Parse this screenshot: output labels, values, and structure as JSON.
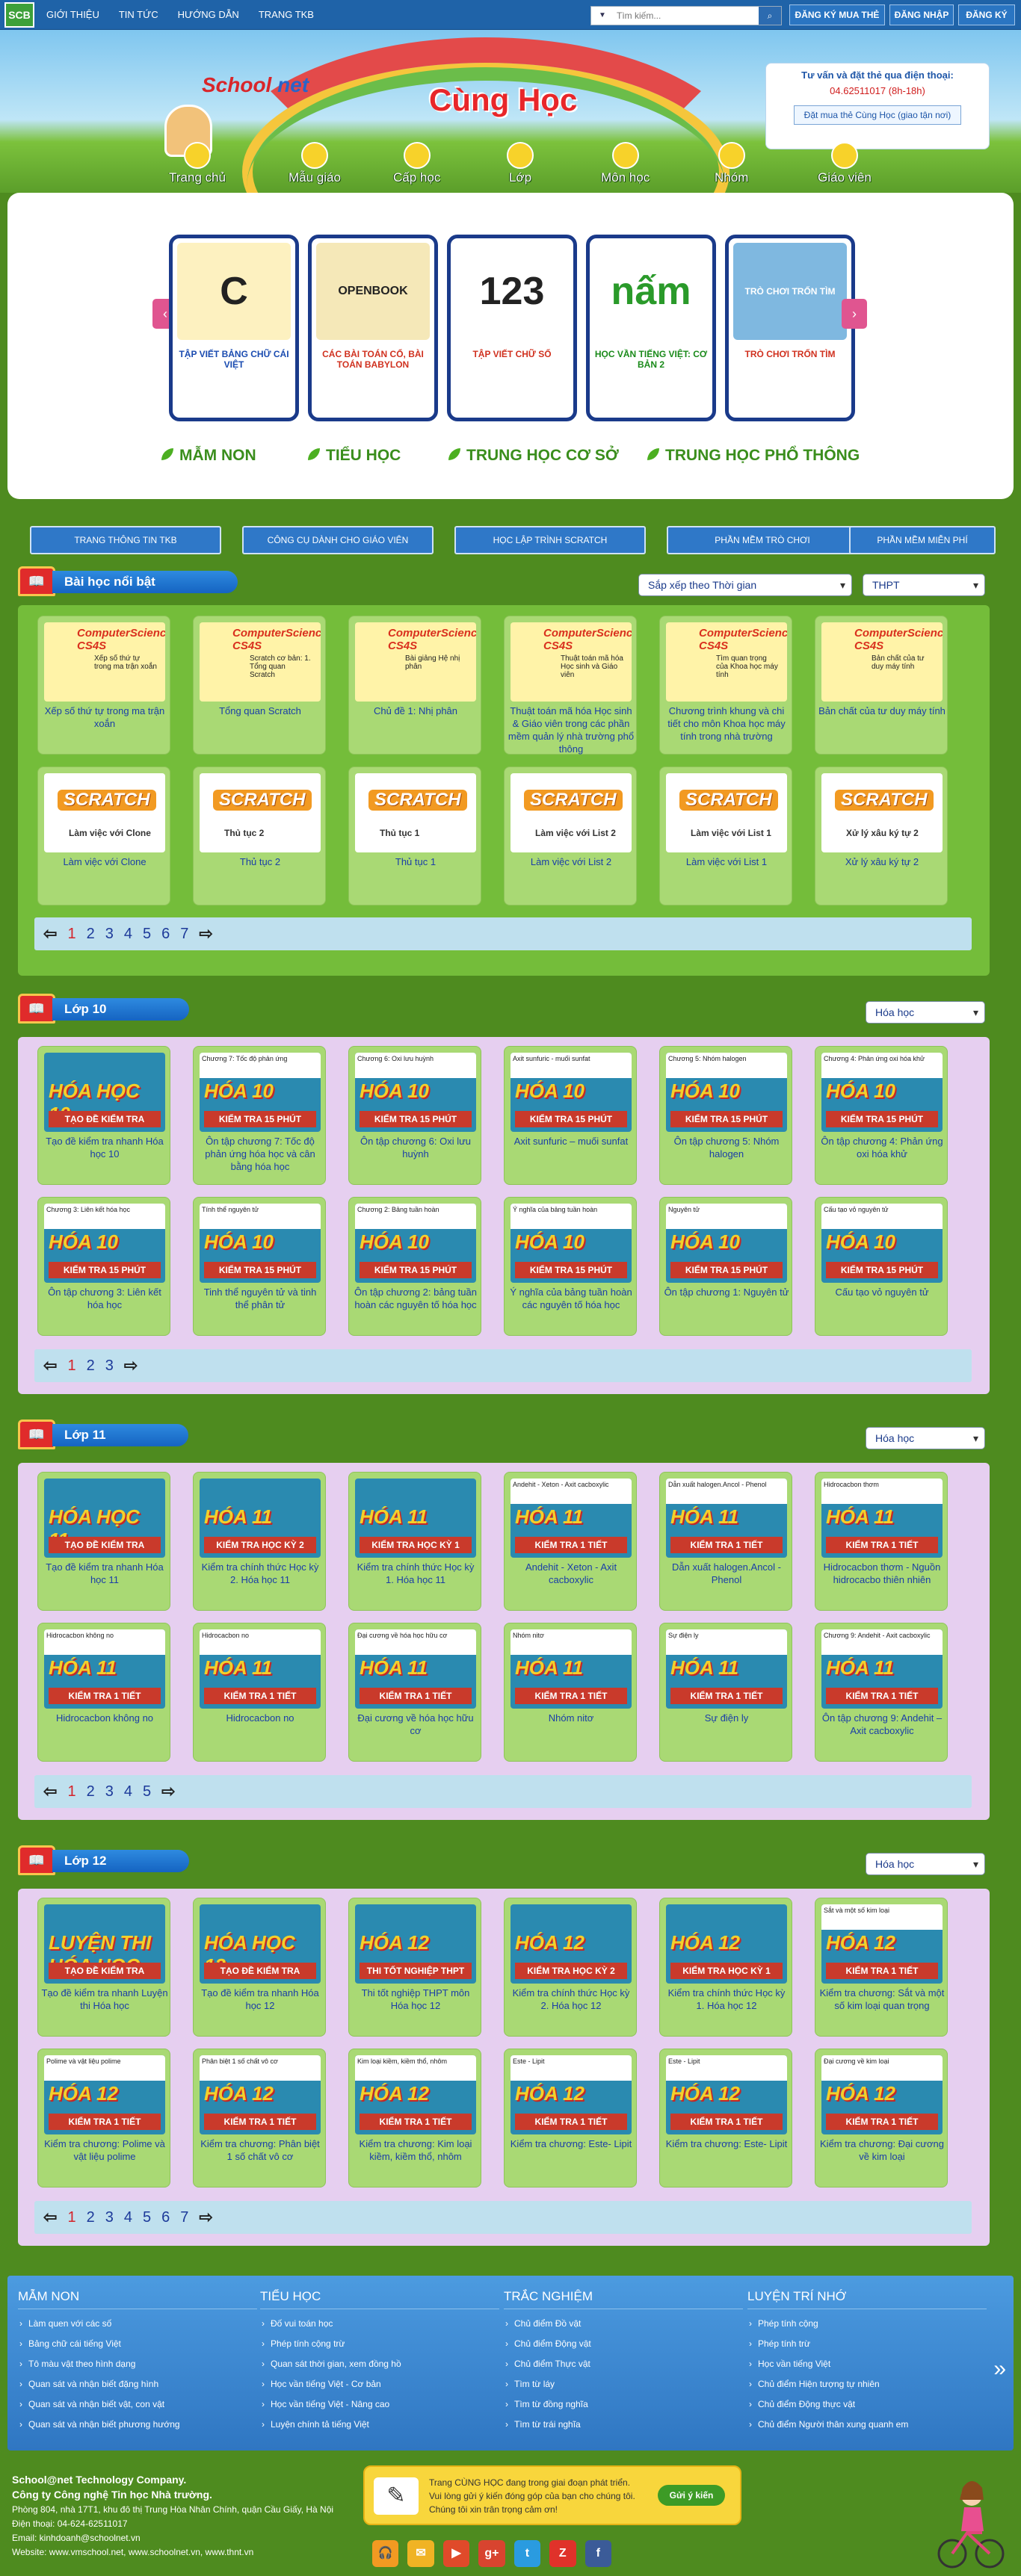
{
  "topbar": {
    "logo": "SCB",
    "nav": [
      "GIỚI THIỆU",
      "TIN TỨC",
      "HƯỚNG DẪN",
      "TRANG TKB"
    ],
    "search_placeholder": "Tìm kiếm...",
    "register_buy": "ĐĂNG KÝ MUA THẺ",
    "login": "ĐĂNG NHẬP",
    "signup": "ĐĂNG KÝ"
  },
  "header": {
    "brand_a": "School",
    "brand_b": "net",
    "title": "Cùng Học",
    "hotline_title": "Tư vấn và đặt thẻ qua điện thoại:",
    "hotline_number": "04.62511017 (8h-18h)",
    "buy_link": "Đặt mua thẻ Cùng Học (giao tận nơi)",
    "categories": [
      "Trang chủ",
      "Mẫu giáo",
      "Cấp học",
      "Lớp",
      "Môn học",
      "Nhóm",
      "Giáo viên"
    ]
  },
  "slider": [
    {
      "img": "C",
      "caption": "TẬP VIẾT BẢNG CHỮ CÁI VIỆT",
      "color": "#f1c64a"
    },
    {
      "img": "OPENBOOK",
      "caption": "CÁC BÀI TOÁN CỔ, BÀI TOÁN BABYLON",
      "color": "#6aa7e6"
    },
    {
      "img": "123",
      "caption": "TẬP VIẾT CHỮ SỐ",
      "color": "#6aa7e6"
    },
    {
      "img": "nấm",
      "caption": "HỌC VẦN TIẾNG VIỆT: CƠ BẢN 2",
      "color": "#e85656"
    },
    {
      "img": "TRÒ CHƠI TRỐN TÌM",
      "caption": "TRÒ CHƠI TRỐN TÌM",
      "color": "#8bc34a"
    }
  ],
  "levels": [
    "MẪM NON",
    "TIỂU HỌC",
    "TRUNG HỌC CƠ SỞ",
    "TRUNG HỌC PHỔ THÔNG"
  ],
  "tools": [
    "TRANG THÔNG TIN TKB",
    "CÔNG CỤ DÀNH CHO GIÁO VIÊN",
    "HỌC LẬP TRÌNH SCRATCH",
    "PHẦN MỀM TRÒ CHƠI",
    "PHẦN MỀM MIỄN PHÍ"
  ],
  "featured": {
    "title": "Bài học nổi bật",
    "sort": "Sắp xếp theo Thời gian",
    "level": "THPT",
    "cards": [
      {
        "head": "ComputerScience CS4S",
        "sub": "Xếp số thứ tự trong ma trận xoắn",
        "cap": "Xếp số thứ tự trong ma trận xoắn"
      },
      {
        "head": "ComputerScience CS4S",
        "sub": "Scratch cơ bản: 1. Tổng quan Scratch",
        "cap": "Tổng quan Scratch"
      },
      {
        "head": "ComputerScience CS4S",
        "sub": "Bài giảng Hệ nhị phân",
        "cap": "Chủ đề 1: Nhị phân"
      },
      {
        "head": "ComputerScience CS4S",
        "sub": "Thuật toán mã hóa Học sinh và Giáo viên",
        "cap": "Thuật toán mã hóa Học sinh & Giáo viên trong các phần mềm quản lý nhà trường phổ thông"
      },
      {
        "head": "ComputerScience CS4S",
        "sub": "Tìm quan trọng của Khoa học máy tính",
        "cap": "Chương trình khung và chi tiết cho môn Khoa học máy tính trong nhà trường"
      },
      {
        "head": "ComputerScience CS4S",
        "sub": "Bản chất của tư duy máy tính",
        "cap": "Bản chất của tư duy máy tính"
      },
      {
        "head": "SCRATCH",
        "sub": "Làm việc với Clone",
        "cap": "Làm việc với Clone"
      },
      {
        "head": "SCRATCH",
        "sub": "Thủ tục 2",
        "cap": "Thủ tục 2"
      },
      {
        "head": "SCRATCH",
        "sub": "Thủ tục 1",
        "cap": "Thủ tục 1"
      },
      {
        "head": "SCRATCH",
        "sub": "Làm việc với List 2",
        "cap": "Làm việc với List 2"
      },
      {
        "head": "SCRATCH",
        "sub": "Làm việc với List 1",
        "cap": "Làm việc với List 1"
      },
      {
        "head": "SCRATCH",
        "sub": "Xử lý xâu ký tự 2",
        "cap": "Xử lý xâu ký tự 2"
      }
    ],
    "pages": [
      "1",
      "2",
      "3",
      "4",
      "5",
      "6",
      "7"
    ]
  },
  "lop10": {
    "title": "Lớp 10",
    "subject": "Hóa học",
    "cards": [
      {
        "head": "",
        "sub": "HÓA HỌC 10",
        "band": "TẠO ĐỀ KIỂM TRA",
        "cap": "Tạo đề kiểm tra nhanh Hóa học 10"
      },
      {
        "head": "Chương 7: Tốc độ phản ứng",
        "sub": "HÓA 10",
        "band": "KIỂM TRA 15 PHÚT",
        "cap": "Ôn tập chương 7: Tốc độ phản ứng hóa học và cân bằng hóa học"
      },
      {
        "head": "Chương 6: Oxi lưu huỳnh",
        "sub": "HÓA 10",
        "band": "KIỂM TRA 15 PHÚT",
        "cap": "Ôn tập chương 6: Oxi lưu huỳnh"
      },
      {
        "head": "Axit sunfuric - muối sunfat",
        "sub": "HÓA 10",
        "band": "KIỂM TRA 15 PHÚT",
        "cap": "Axit sunfuric – muối sunfat"
      },
      {
        "head": "Chương 5: Nhóm halogen",
        "sub": "HÓA 10",
        "band": "KIỂM TRA 15 PHÚT",
        "cap": "Ôn tập chương 5: Nhóm halogen"
      },
      {
        "head": "Chương 4: Phản ứng oxi hóa khử",
        "sub": "HÓA 10",
        "band": "KIỂM TRA 15 PHÚT",
        "cap": "Ôn tập chương 4: Phản ứng oxi hóa khử"
      },
      {
        "head": "Chương 3: Liên kết hóa học",
        "sub": "HÓA 10",
        "band": "KIỂM TRA 15 PHÚT",
        "cap": "Ôn tập chương 3: Liên kết hóa học"
      },
      {
        "head": "Tính thể nguyên tử",
        "sub": "HÓA 10",
        "band": "KIỂM TRA 15 PHÚT",
        "cap": "Tinh thể nguyên tử và tinh thể phân tử"
      },
      {
        "head": "Chương 2: Bảng tuần hoàn",
        "sub": "HÓA 10",
        "band": "KIỂM TRA 15 PHÚT",
        "cap": "Ôn tập chương 2: bảng tuần hoàn các nguyên tố hóa học"
      },
      {
        "head": "Ý nghĩa của bảng tuần hoàn",
        "sub": "HÓA 10",
        "band": "KIỂM TRA 15 PHÚT",
        "cap": "Ý nghĩa của bảng tuần hoàn các nguyên tố hóa học"
      },
      {
        "head": "Nguyên tử",
        "sub": "HÓA 10",
        "band": "KIỂM TRA 15 PHÚT",
        "cap": "Ôn tập chương 1: Nguyên tử"
      },
      {
        "head": "Cấu tạo vỏ nguyên tử",
        "sub": "HÓA 10",
        "band": "KIỂM TRA 15 PHÚT",
        "cap": "Cấu tạo vỏ nguyên tử"
      }
    ],
    "pages": [
      "1",
      "2",
      "3"
    ]
  },
  "lop11": {
    "title": "Lớp 11",
    "subject": "Hóa học",
    "cards": [
      {
        "head": "",
        "sub": "HÓA HỌC 11",
        "band": "TẠO ĐỀ KIỂM TRA",
        "cap": "Tạo đề kiểm tra nhanh Hóa học 11"
      },
      {
        "head": "",
        "sub": "HÓA 11",
        "band": "KIỂM TRA HỌC KỲ 2",
        "cap": "Kiểm tra chính thức Học kỳ 2. Hóa học 11"
      },
      {
        "head": "",
        "sub": "HÓA 11",
        "band": "KIỂM TRA HỌC KỲ 1",
        "cap": "Kiểm tra chính thức Học kỳ 1. Hóa học 11"
      },
      {
        "head": "Andehit - Xeton - Axit cacboxylic",
        "sub": "HÓA 11",
        "band": "KIỂM TRA 1 TIẾT",
        "cap": "Andehit - Xeton - Axit cacboxylic"
      },
      {
        "head": "Dẫn xuất halogen.Ancol - Phenol",
        "sub": "HÓA 11",
        "band": "KIỂM TRA 1 TIẾT",
        "cap": "Dẫn xuất halogen.Ancol - Phenol"
      },
      {
        "head": "Hidrocacbon thơm",
        "sub": "HÓA 11",
        "band": "KIỂM TRA 1 TIẾT",
        "cap": "Hidrocacbon thơm - Nguồn hidrocacbo thiên nhiên"
      },
      {
        "head": "Hidrocacbon không no",
        "sub": "HÓA 11",
        "band": "KIỂM TRA 1 TIẾT",
        "cap": "Hidrocacbon không no"
      },
      {
        "head": "Hidrocacbon no",
        "sub": "HÓA 11",
        "band": "KIỂM TRA 1 TIẾT",
        "cap": "Hidrocacbon no"
      },
      {
        "head": "Đại cương về hóa học hữu cơ",
        "sub": "HÓA 11",
        "band": "KIỂM TRA 1 TIẾT",
        "cap": "Đại cương về hóa học hữu cơ"
      },
      {
        "head": "Nhóm nitơ",
        "sub": "HÓA 11",
        "band": "KIỂM TRA 1 TIẾT",
        "cap": "Nhóm nitơ"
      },
      {
        "head": "Sự điện ly",
        "sub": "HÓA 11",
        "band": "KIỂM TRA 1 TIẾT",
        "cap": "Sự điện ly"
      },
      {
        "head": "Chương 9: Andehit - Axit cacboxylic",
        "sub": "HÓA 11",
        "band": "KIỂM TRA 1 TIẾT",
        "cap": "Ôn tập chương 9: Andehit –Axit cacboxylic"
      }
    ],
    "pages": [
      "1",
      "2",
      "3",
      "4",
      "5"
    ]
  },
  "lop12": {
    "title": "Lớp 12",
    "subject": "Hóa học",
    "cards": [
      {
        "head": "",
        "sub": "LUYỆN THI HÓA HỌC",
        "band": "TẠO ĐỀ KIỂM TRA",
        "cap": "Tạo đề kiểm tra nhanh Luyện thi Hóa học"
      },
      {
        "head": "",
        "sub": "HÓA HỌC 12",
        "band": "TẠO ĐỀ KIỂM TRA",
        "cap": "Tạo đề kiểm tra nhanh Hóa học 12"
      },
      {
        "head": "",
        "sub": "HÓA 12",
        "band": "THI TỐT NGHIỆP THPT",
        "cap": "Thi tốt nghiệp THPT môn Hóa học 12"
      },
      {
        "head": "",
        "sub": "HÓA 12",
        "band": "KIỂM TRA HỌC KỲ 2",
        "cap": "Kiểm tra chính thức Học kỳ 2. Hóa học 12"
      },
      {
        "head": "",
        "sub": "HÓA 12",
        "band": "KIỂM TRA HỌC KỲ 1",
        "cap": "Kiểm tra chính thức Học kỳ 1. Hóa học 12"
      },
      {
        "head": "Sắt và một số kim loại",
        "sub": "HÓA 12",
        "band": "KIỂM TRA 1 TIẾT",
        "cap": "Kiểm tra chương: Sắt và một số kim loại quan trọng"
      },
      {
        "head": "Polime và vật liệu polime",
        "sub": "HÓA 12",
        "band": "KIỂM TRA 1 TIẾT",
        "cap": "Kiểm tra chương: Polime và vật liệu polime"
      },
      {
        "head": "Phân biệt 1 số chất vô cơ",
        "sub": "HÓA 12",
        "band": "KIỂM TRA 1 TIẾT",
        "cap": "Kiểm tra chương: Phân biệt 1 số chất vô cơ"
      },
      {
        "head": "Kim loại kiềm, kiềm thổ, nhôm",
        "sub": "HÓA 12",
        "band": "KIỂM TRA 1 TIẾT",
        "cap": "Kiểm tra chương: Kim loại kiềm, kiềm thổ, nhôm"
      },
      {
        "head": "Este - Lipit",
        "sub": "HÓA 12",
        "band": "KIỂM TRA 1 TIẾT",
        "cap": "Kiểm tra chương: Este- Lipit"
      },
      {
        "head": "Este - Lipit",
        "sub": "HÓA 12",
        "band": "KIỂM TRA 1 TIẾT",
        "cap": "Kiểm tra chương: Este- Lipit"
      },
      {
        "head": "Đại cương về kim loại",
        "sub": "HÓA 12",
        "band": "KIỂM TRA 1 TIẾT",
        "cap": "Kiểm tra chương: Đại cương về kim loại"
      }
    ],
    "pages": [
      "1",
      "2",
      "3",
      "4",
      "5",
      "6",
      "7"
    ]
  },
  "footer": {
    "columns": [
      {
        "title": "MẪM NON",
        "links": [
          "Làm quen với các số",
          "Bảng chữ cái tiếng Việt",
          "Tô màu vật theo hình dạng",
          "Quan sát và nhận biết đặng hình",
          "Quan sát và nhận biết vật, con vật",
          "Quan sát và nhận biết phương hướng"
        ]
      },
      {
        "title": "TIỂU HỌC",
        "links": [
          "Đố vui toán học",
          "Phép tính cộng trừ",
          "Quan sát thời gian, xem đồng hồ",
          "Học vần tiếng Việt - Cơ bản",
          "Học vần tiếng Việt - Nâng cao",
          "Luyện chính tả tiếng Việt"
        ]
      },
      {
        "title": "TRẮC NGHIỆM",
        "links": [
          "Chủ điểm Đồ vật",
          "Chủ điểm Động vật",
          "Chủ điểm Thực vật",
          "Tìm từ láy",
          "Tìm từ đồng nghĩa",
          "Tìm từ trái nghĩa"
        ]
      },
      {
        "title": "LUYỆN TRÍ NHỚ",
        "links": [
          "Phép tính cộng",
          "Phép tính trừ",
          "Học vần tiếng Việt",
          "Chủ điểm Hiện tượng tự nhiên",
          "Chủ điểm Động thực vật",
          "Chủ điểm Người thân xung quanh em"
        ]
      }
    ],
    "company_name": "Công ty Công nghệ Tin học Nhà trường.",
    "company_brand": "School@net Technology Company.",
    "address": "Phòng 804, nhà 17T1, khu đô thị Trung Hòa Nhân Chính, quận Cầu Giấy, Hà Nội",
    "phone": "Điện thoại: 04-624-62511017",
    "email": "Email: kinhdoanh@schoolnet.vn",
    "website": "Website: www.vmschool.net, www.schoolnet.vn, www.thnt.vn",
    "notice_1": "Trang CÙNG HỌC đang trong giai đoạn phát triển.",
    "notice_2": "Vui lòng gửi ý kiến đóng góp của bạn cho chúng tôi.",
    "notice_3": "Chúng tôi xin trân trọng cảm ơn!",
    "notice_button": "Gửi ý kiến",
    "social": [
      "🎧",
      "✉",
      "▶",
      "g+",
      "t",
      "Z",
      "f"
    ]
  }
}
